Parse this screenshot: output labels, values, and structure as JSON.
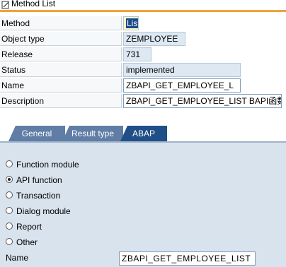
{
  "window": {
    "title": "Method List"
  },
  "fields": [
    {
      "label": "Method",
      "value": "List"
    },
    {
      "label": "Object type",
      "value": "ZEMPLOYEE"
    },
    {
      "label": "Release",
      "value": "731"
    },
    {
      "label": "Status",
      "value": "implemented"
    },
    {
      "label": "Name",
      "value": "ZBAPI_GET_EMPLOYEE_L"
    },
    {
      "label": "Description",
      "value": "ZBAPI_GET_EMPLOYEE_LIST BAPI函数"
    }
  ],
  "tabs": [
    {
      "label": "General",
      "active": false
    },
    {
      "label": "Result type",
      "active": false
    },
    {
      "label": "ABAP",
      "active": true
    }
  ],
  "abap": {
    "options": [
      {
        "label": "Function module",
        "selected": false
      },
      {
        "label": "API function",
        "selected": true
      },
      {
        "label": "Transaction",
        "selected": false
      },
      {
        "label": "Dialog module",
        "selected": false
      },
      {
        "label": "Report",
        "selected": false
      },
      {
        "label": "Other",
        "selected": false
      }
    ],
    "name_label": "Name",
    "name_value": "ZBAPI_GET_EMPLOYEE_LIST"
  },
  "colors": {
    "accent": "#f0a33a",
    "tab_active": "#1f4f86",
    "tab_inactive": "#5f7da5",
    "panel": "#d9e3ee"
  }
}
